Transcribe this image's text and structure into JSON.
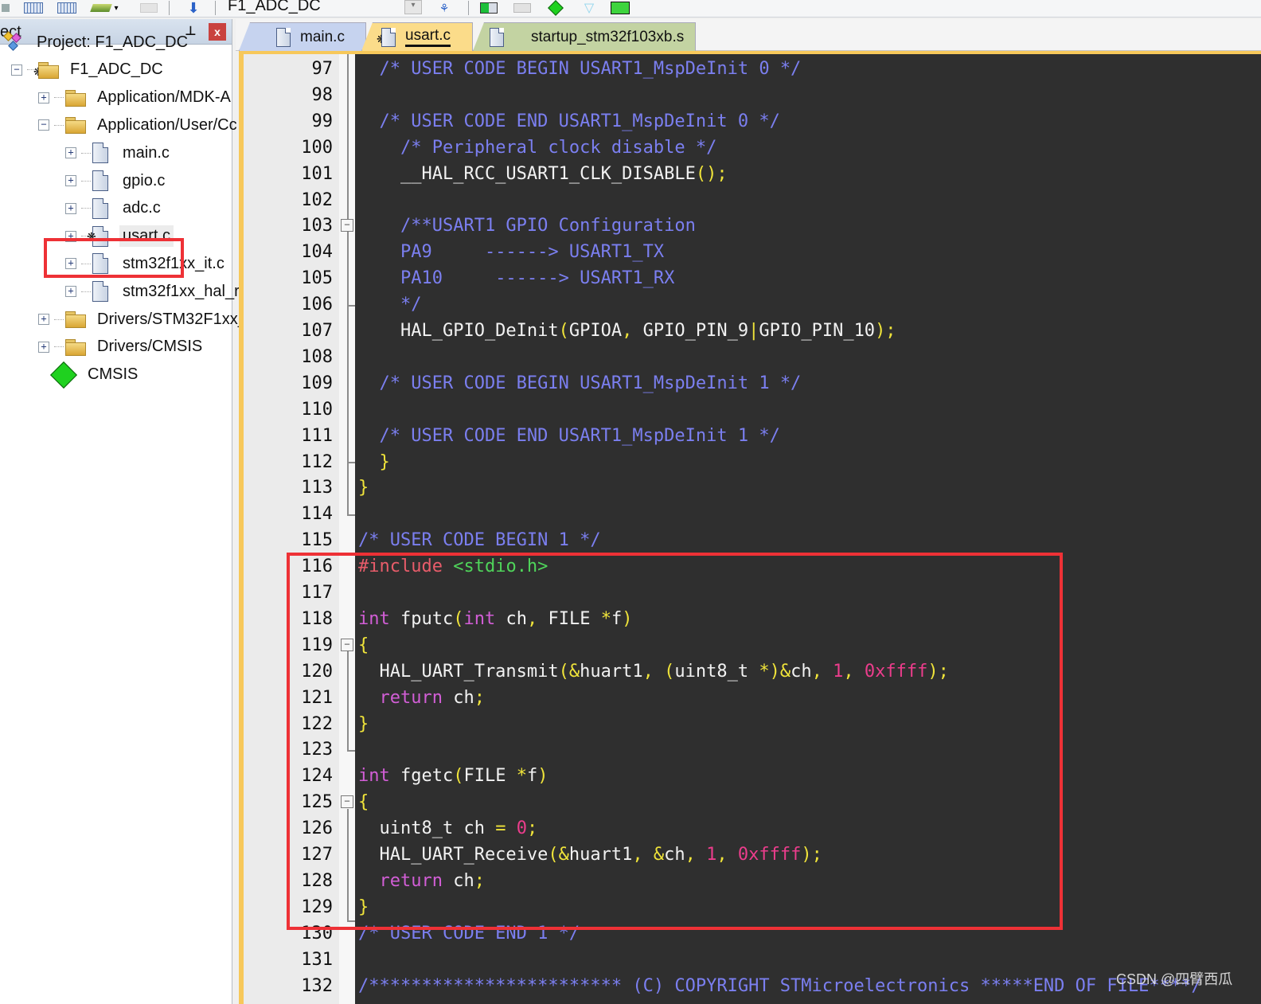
{
  "toolbar": {
    "target_name": "F1_ADC_DC",
    "icons": [
      "batch-build-icon",
      "grid-icon",
      "grid-icon",
      "pack-installer-icon",
      "disabled-delete-icon",
      "download-icon",
      "manage-components-icon",
      "select-pack-icon",
      "insert-icon",
      "green-diamond-icon",
      "filter-icon",
      "checkmark-board-icon"
    ]
  },
  "project_panel": {
    "title": "ect",
    "tree": [
      {
        "label": "Project: F1_ADC_DC",
        "type": "project",
        "level": 0
      },
      {
        "label": "F1_ADC_DC",
        "type": "target",
        "level": 1,
        "toggle": "−"
      },
      {
        "label": "Application/MDK-A",
        "type": "folder",
        "level": 2,
        "toggle": "+"
      },
      {
        "label": "Application/User/Cc",
        "type": "folder-open",
        "level": 2,
        "toggle": "−"
      },
      {
        "label": "main.c",
        "type": "file",
        "level": 3,
        "toggle": "+"
      },
      {
        "label": "gpio.c",
        "type": "file",
        "level": 3,
        "toggle": "+"
      },
      {
        "label": "adc.c",
        "type": "file",
        "level": 3,
        "toggle": "+"
      },
      {
        "label": "usart.c",
        "type": "file-config",
        "level": 3,
        "toggle": "+",
        "selected": true,
        "highlighted": true
      },
      {
        "label": "stm32f1xx_it.c",
        "type": "file",
        "level": 3,
        "toggle": "+"
      },
      {
        "label": "stm32f1xx_hal_r",
        "type": "file",
        "level": 3,
        "toggle": "+"
      },
      {
        "label": "Drivers/STM32F1xx_",
        "type": "folder",
        "level": 2,
        "toggle": "+"
      },
      {
        "label": "Drivers/CMSIS",
        "type": "folder",
        "level": 2,
        "toggle": "+"
      },
      {
        "label": "CMSIS",
        "type": "cmsis",
        "level": 2
      }
    ]
  },
  "tabs": [
    {
      "label": "main.c",
      "color": "#c6d3ef",
      "active": false
    },
    {
      "label": "usart.c",
      "color": "#fbdc8a",
      "active": true
    },
    {
      "label": "startup_stm32f103xb.s",
      "color": "#c3d3a2",
      "active": false
    }
  ],
  "editor": {
    "lines": [
      {
        "n": "97",
        "tokens": [
          [
            "  ",
            ""
          ],
          [
            "/* USER CODE BEGIN USART1_MspDeInit 0 */",
            "c-cmt"
          ]
        ]
      },
      {
        "n": "98",
        "tokens": []
      },
      {
        "n": "99",
        "tokens": [
          [
            "  ",
            ""
          ],
          [
            "/* USER CODE END USART1_MspDeInit 0 */",
            "c-cmt"
          ]
        ]
      },
      {
        "n": "100",
        "tokens": [
          [
            "    ",
            ""
          ],
          [
            "/* Peripheral clock disable */",
            "c-cmt"
          ]
        ]
      },
      {
        "n": "101",
        "tokens": [
          [
            "    __HAL_RCC_USART1_CLK_DISABLE",
            ""
          ],
          [
            "();",
            "c-pun"
          ]
        ]
      },
      {
        "n": "102",
        "tokens": []
      },
      {
        "n": "103",
        "tokens": [
          [
            "    ",
            ""
          ],
          [
            "/**USART1 GPIO Configuration",
            "c-cmt"
          ]
        ]
      },
      {
        "n": "104",
        "tokens": [
          [
            "    ",
            ""
          ],
          [
            "PA9     ------> USART1_TX",
            "c-cmt"
          ]
        ]
      },
      {
        "n": "105",
        "tokens": [
          [
            "    ",
            ""
          ],
          [
            "PA10     ------> USART1_RX",
            "c-cmt"
          ]
        ]
      },
      {
        "n": "106",
        "tokens": [
          [
            "    ",
            ""
          ],
          [
            "*/",
            "c-cmt"
          ]
        ]
      },
      {
        "n": "107",
        "tokens": [
          [
            "    HAL_GPIO_DeInit",
            ""
          ],
          [
            "(",
            "c-pun"
          ],
          [
            "GPIOA",
            ""
          ],
          [
            ",",
            "c-pun"
          ],
          [
            " GPIO_PIN_9",
            ""
          ],
          [
            "|",
            "c-pun"
          ],
          [
            "GPIO_PIN_10",
            ""
          ],
          [
            ");",
            "c-pun"
          ]
        ]
      },
      {
        "n": "108",
        "tokens": []
      },
      {
        "n": "109",
        "tokens": [
          [
            "  ",
            ""
          ],
          [
            "/* USER CODE BEGIN USART1_MspDeInit 1 */",
            "c-cmt"
          ]
        ]
      },
      {
        "n": "110",
        "tokens": []
      },
      {
        "n": "111",
        "tokens": [
          [
            "  ",
            ""
          ],
          [
            "/* USER CODE END USART1_MspDeInit 1 */",
            "c-cmt"
          ]
        ]
      },
      {
        "n": "112",
        "tokens": [
          [
            "  ",
            ""
          ],
          [
            "}",
            "c-pun"
          ]
        ]
      },
      {
        "n": "113",
        "tokens": [
          [
            "}",
            "c-pun"
          ]
        ]
      },
      {
        "n": "114",
        "tokens": []
      },
      {
        "n": "115",
        "tokens": [
          [
            "/* USER CODE BEGIN 1 */",
            "c-cmt"
          ]
        ]
      },
      {
        "n": "116",
        "tokens": [
          [
            "#include ",
            "c-pp"
          ],
          [
            "<stdio.h>",
            "c-str"
          ]
        ]
      },
      {
        "n": "117",
        "tokens": []
      },
      {
        "n": "118",
        "tokens": [
          [
            "int",
            "c-kw"
          ],
          [
            " fputc",
            ""
          ],
          [
            "(",
            "c-pun"
          ],
          [
            "int",
            "c-kw"
          ],
          [
            " ch",
            ""
          ],
          [
            ",",
            "c-pun"
          ],
          [
            " FILE ",
            ""
          ],
          [
            "*",
            "c-pun"
          ],
          [
            "f",
            ""
          ],
          [
            ")",
            "c-pun"
          ]
        ]
      },
      {
        "n": "119",
        "tokens": [
          [
            "{",
            "c-pun"
          ]
        ]
      },
      {
        "n": "120",
        "tokens": [
          [
            "  HAL_UART_Transmit",
            ""
          ],
          [
            "(&",
            "c-pun"
          ],
          [
            "huart1",
            ""
          ],
          [
            ",",
            "c-pun"
          ],
          [
            " ",
            ""
          ],
          [
            "(",
            "c-pun"
          ],
          [
            "uint8_t ",
            ""
          ],
          [
            "*)&",
            "c-pun"
          ],
          [
            "ch",
            ""
          ],
          [
            ",",
            "c-pun"
          ],
          [
            " ",
            ""
          ],
          [
            "1",
            "c-num"
          ],
          [
            ",",
            "c-pun"
          ],
          [
            " ",
            ""
          ],
          [
            "0xffff",
            "c-num"
          ],
          [
            ");",
            "c-pun"
          ]
        ]
      },
      {
        "n": "121",
        "tokens": [
          [
            "  ",
            ""
          ],
          [
            "return",
            "c-kw"
          ],
          [
            " ch",
            ""
          ],
          [
            ";",
            "c-pun"
          ]
        ]
      },
      {
        "n": "122",
        "tokens": [
          [
            "}",
            "c-pun"
          ]
        ]
      },
      {
        "n": "123",
        "tokens": []
      },
      {
        "n": "124",
        "tokens": [
          [
            "int",
            "c-kw"
          ],
          [
            " fgetc",
            ""
          ],
          [
            "(",
            "c-pun"
          ],
          [
            "FILE ",
            ""
          ],
          [
            "*",
            "c-pun"
          ],
          [
            "f",
            ""
          ],
          [
            ")",
            "c-pun"
          ]
        ]
      },
      {
        "n": "125",
        "tokens": [
          [
            "{",
            "c-pun"
          ]
        ]
      },
      {
        "n": "126",
        "tokens": [
          [
            "  uint8_t ch ",
            ""
          ],
          [
            "=",
            "c-pun"
          ],
          [
            " ",
            ""
          ],
          [
            "0",
            "c-num"
          ],
          [
            ";",
            "c-pun"
          ]
        ]
      },
      {
        "n": "127",
        "tokens": [
          [
            "  HAL_UART_Receive",
            ""
          ],
          [
            "(&",
            "c-pun"
          ],
          [
            "huart1",
            ""
          ],
          [
            ",",
            "c-pun"
          ],
          [
            " ",
            ""
          ],
          [
            "&",
            "c-pun"
          ],
          [
            "ch",
            ""
          ],
          [
            ",",
            "c-pun"
          ],
          [
            " ",
            ""
          ],
          [
            "1",
            "c-num"
          ],
          [
            ",",
            "c-pun"
          ],
          [
            " ",
            ""
          ],
          [
            "0xffff",
            "c-num"
          ],
          [
            ");",
            "c-pun"
          ]
        ]
      },
      {
        "n": "128",
        "tokens": [
          [
            "  ",
            ""
          ],
          [
            "return",
            "c-kw"
          ],
          [
            " ch",
            ""
          ],
          [
            ";",
            "c-pun"
          ]
        ]
      },
      {
        "n": "129",
        "tokens": [
          [
            "}",
            "c-pun"
          ]
        ]
      },
      {
        "n": "130",
        "tokens": [
          [
            "/* USER CODE END 1 */",
            "c-cmt"
          ]
        ]
      },
      {
        "n": "131",
        "tokens": []
      },
      {
        "n": "132",
        "tokens": [
          [
            "/************************ (C) COPYRIGHT STMicroelectronics *****END OF FILE****/",
            "c-cmt"
          ]
        ]
      }
    ],
    "fold_markers": [
      {
        "line": "103",
        "symbol": "−"
      },
      {
        "line": "119",
        "symbol": "−"
      },
      {
        "line": "125",
        "symbol": "−"
      }
    ],
    "highlight_range": {
      "from": "116",
      "to": "129"
    }
  },
  "watermark": "CSDN @四臂西瓜",
  "colors": {
    "editor_bg": "#2f2f2f",
    "comment": "#7b7ff0",
    "keyword": "#d25ed6",
    "preprocessor": "#e85c6a",
    "string": "#4fd45a",
    "number": "#ec3d8c",
    "punctuation": "#f0e43a",
    "highlight_box": "#ee3136"
  }
}
